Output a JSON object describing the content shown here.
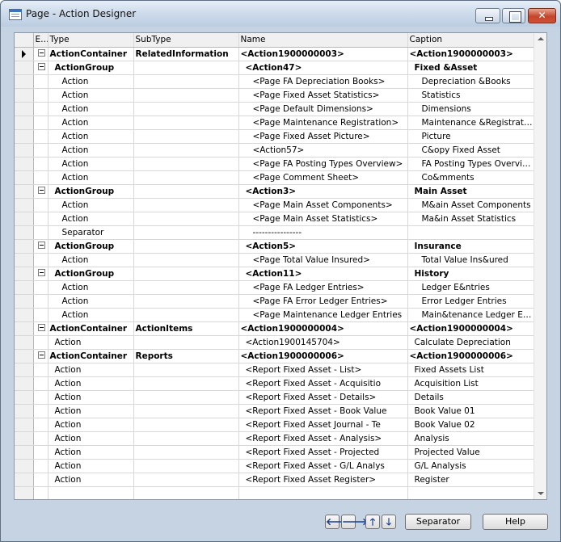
{
  "window": {
    "title": "Page - Action Designer"
  },
  "columns": {
    "e": "E...",
    "type": "Type",
    "subtype": "SubType",
    "name": "Name",
    "caption": "Caption"
  },
  "rows": [
    {
      "type": "ActionContainer",
      "subtype": "RelatedInformation",
      "name": "<Action1900000003>",
      "caption": "<Action1900000003>",
      "level": 0,
      "bold": true,
      "expander": true,
      "current": true
    },
    {
      "type": "ActionGroup",
      "subtype": "",
      "name": "<Action47>",
      "caption": "Fixed &Asset",
      "level": 1,
      "bold": true,
      "expander": true
    },
    {
      "type": "Action",
      "subtype": "",
      "name": "<Page FA Depreciation Books>",
      "caption": "Depreciation &Books",
      "level": 2
    },
    {
      "type": "Action",
      "subtype": "",
      "name": "<Page Fixed Asset Statistics>",
      "caption": "Statistics",
      "level": 2
    },
    {
      "type": "Action",
      "subtype": "",
      "name": "<Page Default Dimensions>",
      "caption": "Dimensions",
      "level": 2
    },
    {
      "type": "Action",
      "subtype": "",
      "name": "<Page Maintenance Registration>",
      "caption": "Maintenance &Registration",
      "level": 2
    },
    {
      "type": "Action",
      "subtype": "",
      "name": "<Page Fixed Asset Picture>",
      "caption": "Picture",
      "level": 2
    },
    {
      "type": "Action",
      "subtype": "",
      "name": "<Action57>",
      "caption": "C&opy Fixed Asset",
      "level": 2
    },
    {
      "type": "Action",
      "subtype": "",
      "name": "<Page FA Posting Types Overview>",
      "caption": "FA Posting Types Overview",
      "level": 2
    },
    {
      "type": "Action",
      "subtype": "",
      "name": "<Page Comment Sheet>",
      "caption": "Co&mments",
      "level": 2
    },
    {
      "type": "ActionGroup",
      "subtype": "",
      "name": "<Action3>",
      "caption": "Main Asset",
      "level": 1,
      "bold": true,
      "expander": true
    },
    {
      "type": "Action",
      "subtype": "",
      "name": "<Page Main Asset Components>",
      "caption": "M&ain Asset Components",
      "level": 2
    },
    {
      "type": "Action",
      "subtype": "",
      "name": "<Page Main Asset Statistics>",
      "caption": "Ma&in Asset Statistics",
      "level": 2
    },
    {
      "type": "Separator",
      "subtype": "",
      "name": "----------------",
      "caption": "",
      "level": 2
    },
    {
      "type": "ActionGroup",
      "subtype": "",
      "name": "<Action5>",
      "caption": "Insurance",
      "level": 1,
      "bold": true,
      "expander": true
    },
    {
      "type": "Action",
      "subtype": "",
      "name": "<Page Total Value Insured>",
      "caption": "Total Value Ins&ured",
      "level": 2
    },
    {
      "type": "ActionGroup",
      "subtype": "",
      "name": "<Action11>",
      "caption": "History",
      "level": 1,
      "bold": true,
      "expander": true
    },
    {
      "type": "Action",
      "subtype": "",
      "name": "<Page FA Ledger Entries>",
      "caption": "Ledger E&ntries",
      "level": 2
    },
    {
      "type": "Action",
      "subtype": "",
      "name": "<Page FA Error Ledger Entries>",
      "caption": "Error Ledger Entries",
      "level": 2
    },
    {
      "type": "Action",
      "subtype": "",
      "name": "<Page Maintenance Ledger Entries",
      "caption": "Main&tenance Ledger En...",
      "level": 2
    },
    {
      "type": "ActionContainer",
      "subtype": "ActionItems",
      "name": "<Action1900000004>",
      "caption": "<Action1900000004>",
      "level": 0,
      "bold": true,
      "expander": true
    },
    {
      "type": "Action",
      "subtype": "",
      "name": "<Action1900145704>",
      "caption": "Calculate Depreciation",
      "level": 1
    },
    {
      "type": "ActionContainer",
      "subtype": "Reports",
      "name": "<Action1900000006>",
      "caption": "<Action1900000006>",
      "level": 0,
      "bold": true,
      "expander": true
    },
    {
      "type": "Action",
      "subtype": "",
      "name": "<Report Fixed Asset - List>",
      "caption": "Fixed Assets List",
      "level": 1
    },
    {
      "type": "Action",
      "subtype": "",
      "name": "<Report Fixed Asset - Acquisitio",
      "caption": "Acquisition List",
      "level": 1
    },
    {
      "type": "Action",
      "subtype": "",
      "name": "<Report Fixed Asset - Details>",
      "caption": "Details",
      "level": 1
    },
    {
      "type": "Action",
      "subtype": "",
      "name": "<Report Fixed Asset - Book Value",
      "caption": "Book Value 01",
      "level": 1
    },
    {
      "type": "Action",
      "subtype": "",
      "name": "<Report Fixed Asset Journal - Te",
      "caption": "Book Value 02",
      "level": 1
    },
    {
      "type": "Action",
      "subtype": "",
      "name": "<Report Fixed Asset - Analysis>",
      "caption": "Analysis",
      "level": 1
    },
    {
      "type": "Action",
      "subtype": "",
      "name": "<Report Fixed Asset - Projected",
      "caption": "Projected Value",
      "level": 1
    },
    {
      "type": "Action",
      "subtype": "",
      "name": "<Report Fixed Asset - G/L Analys",
      "caption": "G/L Analysis",
      "level": 1
    },
    {
      "type": "Action",
      "subtype": "",
      "name": "<Report Fixed Asset Register>",
      "caption": "Register",
      "level": 1
    },
    {
      "type": "",
      "subtype": "",
      "name": "",
      "caption": "",
      "level": 0
    }
  ],
  "buttons": {
    "separator": "Separator",
    "help": "Help",
    "left_icon": "arrow-left-icon",
    "right_icon": "arrow-right-icon",
    "up_icon": "arrow-up-icon",
    "down_icon": "arrow-down-icon"
  }
}
